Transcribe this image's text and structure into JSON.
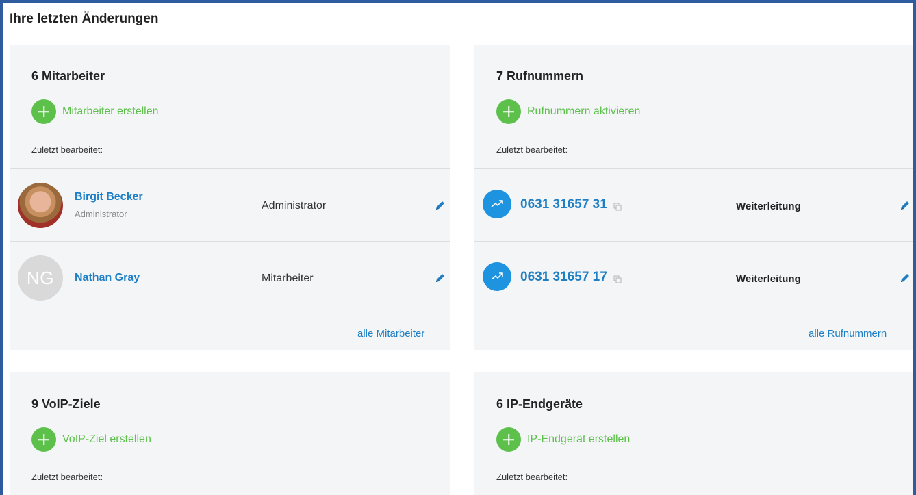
{
  "page": {
    "title": "Ihre letzten Änderungen"
  },
  "mitarbeiter": {
    "title": "6 Mitarbeiter",
    "action": "Mitarbeiter erstellen",
    "last_edited": "Zuletzt bearbeitet:",
    "rows": [
      {
        "name": "Birgit Becker",
        "subtitle": "Administrator",
        "role": "Administrator",
        "avatar": "photo"
      },
      {
        "name": "Nathan Gray",
        "initials": "NG",
        "role": "Mitarbeiter",
        "avatar": "initials"
      }
    ],
    "footer_link": "alle Mitarbeiter"
  },
  "rufnummern": {
    "title": "7 Rufnummern",
    "action": "Rufnummern aktivieren",
    "last_edited": "Zuletzt bearbeitet:",
    "rows": [
      {
        "number": "0631 31657 31",
        "type": "Weiterleitung"
      },
      {
        "number": "0631 31657 17",
        "type": "Weiterleitung"
      }
    ],
    "footer_link": "alle Rufnummern"
  },
  "voip": {
    "title": "9 VoIP-Ziele",
    "action": "VoIP-Ziel erstellen",
    "last_edited": "Zuletzt bearbeitet:"
  },
  "endgeraete": {
    "title": "6 IP-Endgeräte",
    "action": "IP-Endgerät erstellen",
    "last_edited": "Zuletzt bearbeitet:"
  },
  "icons": {
    "add": "plus-circle-icon",
    "edit": "pencil-icon",
    "phone": "outgoing-arrow-icon",
    "copy": "copy-icon"
  },
  "colors": {
    "accent_green": "#5cc04b",
    "link_blue": "#1e7fc4",
    "phone_blue": "#1e93e0",
    "card_bg": "#f4f5f7",
    "frame_border": "#2f5c9e"
  }
}
